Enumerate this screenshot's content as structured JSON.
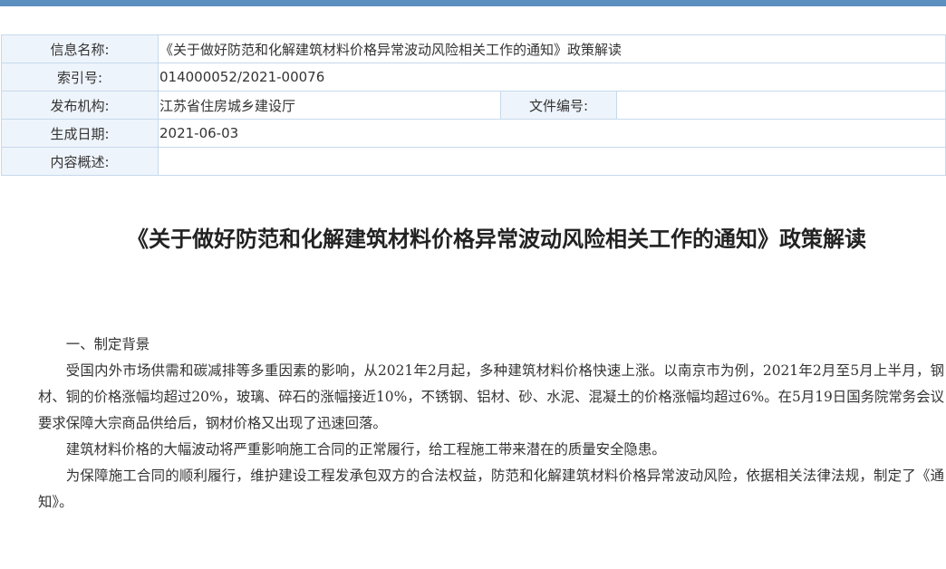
{
  "info": {
    "name_label": "信息名称:",
    "name_value": "《关于做好防范和化解建筑材料价格异常波动风险相关工作的通知》政策解读",
    "index_label": "索引号:",
    "index_value": "014000052/2021-00076",
    "publisher_label": "发布机构:",
    "publisher_value": "江苏省住房城乡建设厅",
    "docno_label": "文件编号:",
    "docno_value": "",
    "date_label": "生成日期:",
    "date_value": "2021-06-03",
    "summary_label": "内容概述:",
    "summary_value": ""
  },
  "article": {
    "title": "《关于做好防范和化解建筑材料价格异常波动风险相关工作的通知》政策解读",
    "paragraphs": [
      "一、制定背景",
      "受国内外市场供需和碳减排等多重因素的影响，从2021年2月起，多种建筑材料价格快速上涨。以南京市为例，2021年2月至5月上半月，钢材、铜的价格涨幅均超过20%，玻璃、碎石的涨幅接近10%，不锈钢、铝材、砂、水泥、混凝土的价格涨幅均超过6%。在5月19日国务院常务会议要求保障大宗商品供给后，钢材价格又出现了迅速回落。",
      "建筑材料价格的大幅波动将严重影响施工合同的正常履行，给工程施工带来潜在的质量安全隐患。",
      "为保障施工合同的顺利履行，维护建设工程发承包双方的合法权益，防范和化解建筑材料价格异常波动风险，依据相关法律法规，制定了《通知》。"
    ]
  }
}
